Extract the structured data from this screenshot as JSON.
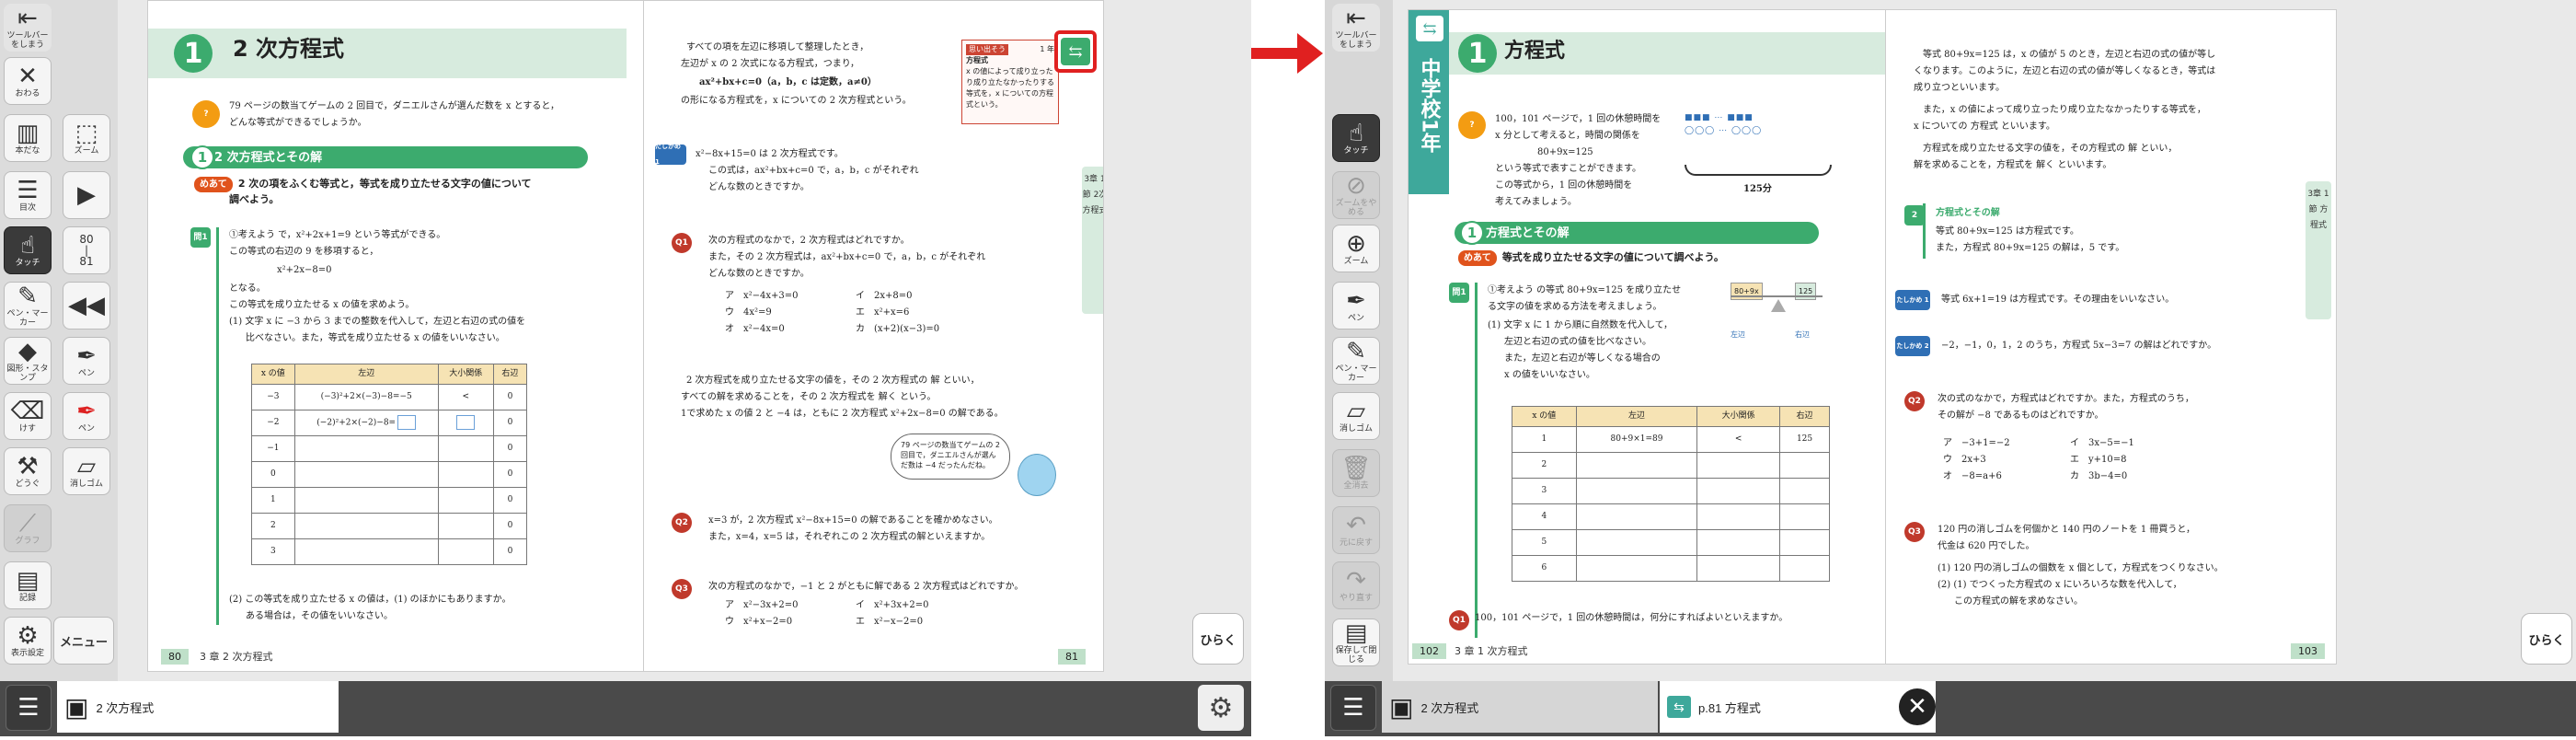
{
  "colors": {
    "accent_green": "#3cab6e",
    "highlight_red": "#e02020",
    "goal_orange": "#e0531c"
  },
  "left": {
    "toolbar": {
      "toolbar_hide": "ツールバーをしまう",
      "close": "おわる",
      "bookshelf": "本だな",
      "toc": "目次",
      "zoom": "ズーム",
      "touch": "タッチ",
      "page_range": "80\n|\n81",
      "pen_marker": "ペン・マーカー",
      "pen": "ペン",
      "pen_red": "ペン",
      "stamp": "図形・スタンプ",
      "eraser_red": "消しゴム",
      "erase": "けす",
      "tools": "どうぐ",
      "graph": "グラフ",
      "record": "記録",
      "display": "表示設定",
      "menu": "メニュー"
    },
    "page80": {
      "chapter_num": "1",
      "chapter_title": "2 次方程式",
      "intro_line1": "79 ページの数当てゲームの 2 回目で，ダニエルさんが選んだ数を x とすると，",
      "intro_line2": "どんな等式ができるでしょうか。",
      "section_num": "1",
      "section_title": "2 次方程式とその解",
      "goal_tag": "めあて",
      "goal_text1": "2 次の項をふくむ等式と，等式を成り立たせる文字の値について",
      "goal_text2": "調べよう。",
      "q_mark": "問1",
      "q_line1": "①考えよう で，x²+2x+1=9 という等式ができる。",
      "q_line2": "この等式の右辺の 9 を移項すると，",
      "q_line3": "x²+2x−8=0",
      "q_line4": "となる。",
      "q_line5": "この等式を成り立たせる x の値を求めよう。",
      "q_line6": "(1) 文字 x に −3 から 3 までの整数を代入して，左辺と右辺の式の値を",
      "q_line7": "比べなさい。また，等式を成り立たせる x の値をいいなさい。",
      "table_headers": [
        "x の値",
        "左辺",
        "大小関係",
        "右辺"
      ],
      "table_rows": [
        [
          "−3",
          "(−3)²+2×(−3)−8=−5",
          "<",
          "0"
        ],
        [
          "−2",
          "(−2)²+2×(−2)−8=",
          "",
          "0"
        ],
        [
          "−1",
          "",
          "",
          "0"
        ],
        [
          "0",
          "",
          "",
          "0"
        ],
        [
          "1",
          "",
          "",
          "0"
        ],
        [
          "2",
          "",
          "",
          "0"
        ],
        [
          "3",
          "",
          "",
          "0"
        ]
      ],
      "q2_line1": "(2) この等式を成り立たせる x の値は，(1) のほかにもありますか。",
      "q2_line2": "ある場合は，その値をいいなさい。",
      "folio_num": "80",
      "folio_text": "3 章 2 次方程式"
    },
    "page81": {
      "p1": "すべての項を左辺に移項して整理したとき，",
      "p2": "左辺が x の 2 次式になる方程式，つまり，",
      "p3": "ax²+bx+c=0（a，b，c は定数，a≠0）",
      "p4": "の形になる方程式を，x についての 2 次方程式という。",
      "memo_title": "思い出そう",
      "memo_ref": "1 年",
      "memo_head": "方程式",
      "memo_body": "x の値によって成り立ったり成り立たなかったりする等式を，x についての方程式という。",
      "ex1_tag": "たしかめ 1",
      "ex1_a": "x²−8x+15=0 は 2 次方程式です。",
      "ex1_b": "この式は，ax²+bx+c=0 で，a，b，c がそれぞれ",
      "ex1_c": "どんな数のときですか。",
      "q1_tag": "Q1",
      "q1_a": "次の方程式のなかで，2 次方程式はどれですか。",
      "q1_b": "また，その 2 次方程式は，ax²+bx+c=0 で，a，b，c がそれぞれ",
      "q1_c": "どんな数のときですか。",
      "q1_opts": [
        "ア　x²−4x+3=0",
        "イ　2x+8=0",
        "ウ　4x²=9",
        "エ　x²+x=6",
        "オ　x²−4x=0",
        "カ　(x+2)(x−3)=0"
      ],
      "sol_a": "2 次方程式を成り立たせる文字の値を，その 2 次方程式の 解 といい，",
      "sol_b": "すべての解を求めることを，その 2 次方程式を 解く という。",
      "sol_c": "1で求めた x の値 2 と −4 は，ともに 2 次方程式 x²+2x−8=0 の解である。",
      "speech": "79 ページの数当てゲームの 2 回目で，ダニエルさんが選んだ数は −4 だったんだね。",
      "q2_tag": "Q2",
      "q2_a": "x=3 が，2 次方程式 x²−8x+15=0 の解であることを確かめなさい。",
      "q2_b": "また，x=4，x=5 は，それぞれこの 2 次方程式の解といえますか。",
      "q3_tag": "Q3",
      "q3_a": "次の方程式のなかで，−1 と 2 がともに解である 2 次方程式はどれですか。",
      "q3_opts": [
        "ア　x²−3x+2=0",
        "イ　x²+3x+2=0",
        "ウ　x²+x−2=0",
        "エ　x²−x−2=0"
      ],
      "side_tab": "3章 1節 2次方程式",
      "folio_num": "81"
    },
    "hiraku": "ひらく",
    "tab_label": "2 次方程式"
  },
  "right": {
    "toolbar": {
      "toolbar_hide": "ツールバーをしまう",
      "touch": "タッチ",
      "zoom_stop": "ズームをやめる",
      "zoom": "ズーム",
      "pen": "ペン",
      "pen_marker": "ペン・マーカー",
      "eraser": "消しゴム",
      "clear_all": "全消去",
      "undo": "元に戻す",
      "redo": "やり直す",
      "save_close": "保存して閉じる"
    },
    "page102": {
      "band_label": "中学校1年",
      "chapter_num": "1",
      "chapter_title": "方程式",
      "i1": "100，101 ページで，1 回の休憩時間を",
      "i2": "x 分として考えると，時間の関係を",
      "i3": "80+9x=125",
      "i4": "という等式で表すことができます。",
      "i5": "この等式から，1 回の休憩時間を",
      "i6": "考えてみましょう。",
      "brace_label": "125分",
      "section_num": "1",
      "section_title": "方程式とその解",
      "goal_tag": "めあて",
      "goal_text": "等式を成り立たせる文字の値について調べよう。",
      "q_mark": "問1",
      "q1": "①考えよう の等式 80+9x=125 を成り立たせ",
      "q2": "る文字の値を求める方法を考えましょう。",
      "q3": "(1) 文字 x に 1 から順に自然数を代入して，",
      "q4": "左辺と右辺の式の値を比べなさい。",
      "q5": "また，左辺と右辺が等しくなる場合の",
      "q6": "x の値をいいなさい。",
      "scale_left": "80+9x",
      "scale_right": "125",
      "scale_left_label": "左辺",
      "scale_right_label": "右辺",
      "table_headers": [
        "x の値",
        "左辺",
        "大小関係",
        "右辺"
      ],
      "table_rows": [
        [
          "1",
          "80+9×1=89",
          "<",
          "125"
        ],
        [
          "2",
          "",
          "",
          ""
        ],
        [
          "3",
          "",
          "",
          ""
        ],
        [
          "4",
          "",
          "",
          ""
        ],
        [
          "5",
          "",
          "",
          ""
        ],
        [
          "6",
          "",
          "",
          ""
        ]
      ],
      "q_last_tag": "Q1",
      "q_last": "100，101 ページで，1 回の休憩時間は，何分にすればよいといえますか。",
      "folio_num": "102",
      "folio_text": "3 章 1 次方程式"
    },
    "page103": {
      "p1": "等式 80+9x=125 は，x の値が 5 のとき，左辺と右辺の式の値が等し",
      "p2": "くなります。このように，左辺と右辺の式の値が等しくなるとき，等式は",
      "p3": "成り立つといいます。",
      "p4": "また，x の値によって成り立ったり成り立たなかったりする等式を，",
      "p5": "x についての 方程式 といいます。",
      "p6": "方程式を成り立たせる文字の値を，その方程式の 解 といい，",
      "p7": "解を求めることを，方程式を 解く といいます。",
      "ex_tag": "2",
      "ex_title": "方程式とその解",
      "ex_a": "等式 80+9x=125 は方程式です。",
      "ex_b": "また，方程式 80+9x=125 の解は，5 です。",
      "c1_tag": "たしかめ 1",
      "c1": "等式 6x+1=19 は方程式です。その理由をいいなさい。",
      "c2_tag": "たしかめ 2",
      "c2": "−2，−1，0，1，2 のうち，方程式 5x−3=7 の解はどれですか。",
      "q2_tag": "Q2",
      "q2_a": "次の式のなかで，方程式はどれですか。また，方程式のうち，",
      "q2_b": "その解が −8 であるものはどれですか。",
      "q2_opts": [
        "ア　−3+1=−2",
        "イ　3x−5=−1",
        "ウ　2x+3",
        "エ　y+10=8",
        "オ　−8=a+6",
        "カ　3b−4=0"
      ],
      "q3_tag": "Q3",
      "q3_a": "120 円の消しゴムを何個かと 140 円のノートを 1 冊買うと，",
      "q3_b": "代金は 620 円でした。",
      "q3_c": "(1) 120 円の消しゴムの個数を x 個として，方程式をつくりなさい。",
      "q3_d": "(2) (1) でつくった方程式の x にいろいろな数を代入して，",
      "q3_e": "この方程式の解を求めなさい。",
      "side_tab": "3章 1節 方程式",
      "folio_num": "103"
    },
    "hiraku": "ひらく",
    "tab1_label": "2 次方程式",
    "tab2_label": "p.81 方程式"
  }
}
